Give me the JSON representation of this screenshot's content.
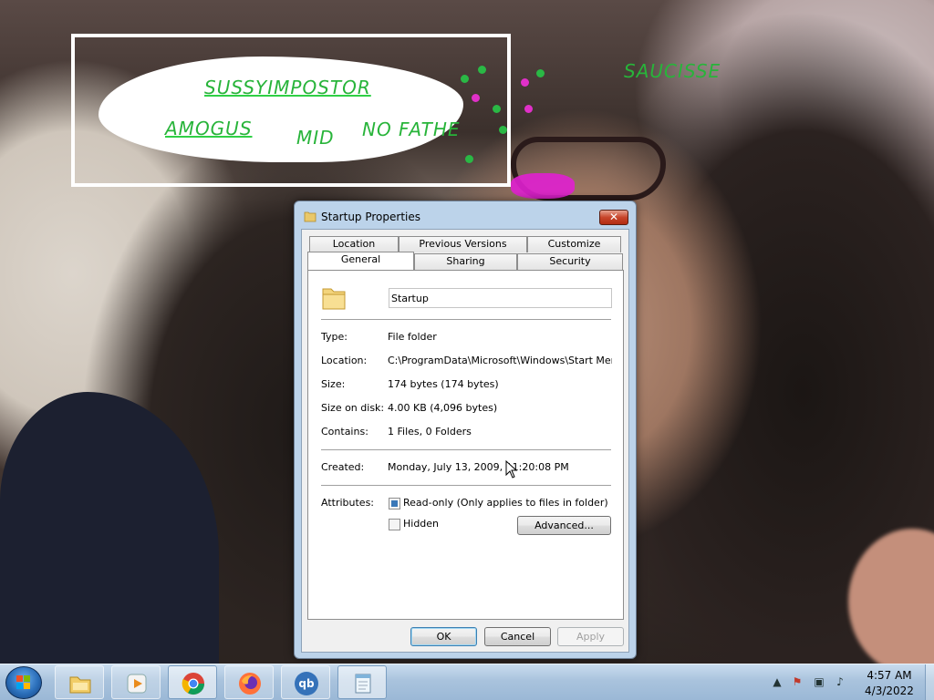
{
  "desktop": {
    "doodle": {
      "texts": [
        "SUSSYIMPOSTOR",
        "AMOGUS",
        "MID",
        "NO FATHE",
        "SAUCISSE"
      ]
    }
  },
  "window": {
    "title": "Startup Properties",
    "close_label": "✕",
    "tabs_row1": [
      "Location",
      "Previous Versions",
      "Customize"
    ],
    "tabs_row2": [
      "General",
      "Sharing",
      "Security"
    ],
    "active_tab": "General",
    "name_value": "Startup",
    "properties": [
      {
        "label": "Type:",
        "value": "File folder"
      },
      {
        "label": "Location:",
        "value": "C:\\ProgramData\\Microsoft\\Windows\\Start Menu\\Pr"
      },
      {
        "label": "Size:",
        "value": "174 bytes (174 bytes)"
      },
      {
        "label": "Size on disk:",
        "value": "4.00 KB (4,096 bytes)"
      },
      {
        "label": "Contains:",
        "value": "1 Files, 0 Folders"
      }
    ],
    "created_label": "Created:",
    "created_value": "Monday, July 13, 2009, 11:20:08 PM",
    "attributes_label": "Attributes:",
    "readonly_label": "Read-only (Only applies to files in folder)",
    "readonly_checked": true,
    "hidden_label": "Hidden",
    "hidden_checked": false,
    "advanced_label": "Advanced...",
    "ok_label": "OK",
    "cancel_label": "Cancel",
    "apply_label": "Apply"
  },
  "taskbar": {
    "apps": [
      "windows-explorer",
      "windows-media-player",
      "google-chrome",
      "firefox",
      "qbittorrent",
      "notepad"
    ],
    "qb_label": "qb",
    "time": "4:57 AM",
    "date": "4/3/2022"
  },
  "colors": {
    "doodle_green": "#28b43a",
    "taskbar": "#a9c3dd",
    "close_red": "#c7452b"
  }
}
